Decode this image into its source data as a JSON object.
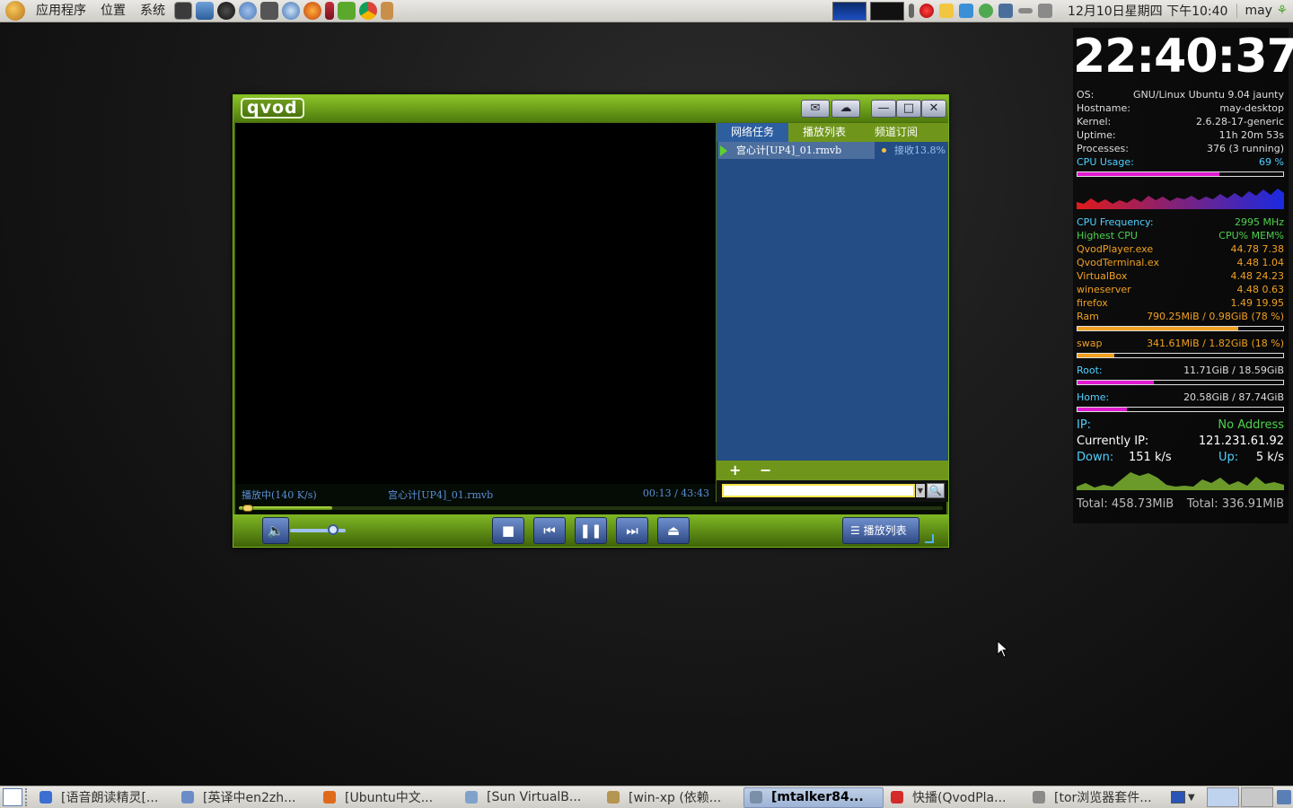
{
  "top_panel": {
    "menus": [
      "应用程序",
      "位置",
      "系统"
    ],
    "datetime": "12月10日星期四 下午10:40",
    "user": "may"
  },
  "conky": {
    "clock": "22:40:37",
    "os_label": "OS:",
    "os_value": "GNU/Linux Ubuntu 9.04 jaunty",
    "hostname_label": "Hostname:",
    "hostname_value": "may-desktop",
    "kernel_label": "Kernel:",
    "kernel_value": "2.6.28-17-generic",
    "uptime_label": "Uptime:",
    "uptime_value": "11h 20m 53s",
    "processes_label": "Processes:",
    "processes_value": "376  (3  running)",
    "cpu_label": "CPU Usage:",
    "cpu_value": "69 %",
    "cpu_fraction": 0.69,
    "freq_label": "CPU Frequency:",
    "freq_value": "2995  MHz",
    "highest_label": "Highest CPU",
    "highest_cols": "CPU% MEM%",
    "procs": [
      {
        "name": "QvodPlayer.exe",
        "vals": "44.78  7.38"
      },
      {
        "name": "QvodTerminal.ex",
        "vals": "4.48  1.04"
      },
      {
        "name": "VirtualBox",
        "vals": "4.48 24.23"
      },
      {
        "name": "wineserver",
        "vals": "4.48  0.63"
      },
      {
        "name": "firefox",
        "vals": "1.49 19.95"
      }
    ],
    "ram_label": "Ram",
    "ram_value": "790.25MiB / 0.98GiB  (78 %)",
    "ram_fraction": 0.78,
    "swap_label": "swap",
    "swap_value": "341.61MiB / 1.82GiB  (18 %)",
    "swap_fraction": 0.18,
    "root_label": "Root:",
    "root_value": "11.71GiB  / 18.59GiB",
    "root_fraction": 0.37,
    "home_label": "Home:",
    "home_value": "20.58GiB  / 87.74GiB",
    "home_fraction": 0.24,
    "ip_label": "IP:",
    "ip_value": "No Address",
    "current_ip_label": "Currently IP:",
    "current_ip_value": "121.231.61.92",
    "down_label": "Down:",
    "down_value": "151   k/s",
    "up_label": "Up:",
    "up_value": "5    k/s",
    "total_down": "Total: 458.73MiB",
    "total_up": "Total: 336.91MiB"
  },
  "qvod": {
    "logo": "qvod",
    "tabs": [
      "网络任务",
      "播放列表",
      "频道订阅"
    ],
    "task_name": "宫心计[UP4]_01.rmvb",
    "task_status": "接收13.8%",
    "status_play": "播放中(140 K/s)",
    "status_file": "宫心计[UP4]_01.rmvb",
    "status_time": "00:13 / 43:43",
    "seek_fraction": 0.005,
    "volume_fraction": 0.78,
    "add_label": "+",
    "remove_label": "−",
    "playlist_button": "播放列表"
  },
  "taskbar": [
    {
      "label": "[语音朗读精灵[...",
      "color": "#3b6fd1"
    },
    {
      "label": "[英译中en2zh...",
      "color": "#6c8cc8"
    },
    {
      "label": "[Ubuntu中文...",
      "color": "#e06a1c"
    },
    {
      "label": "[Sun VirtualB...",
      "color": "#7ea2cc"
    },
    {
      "label": "[win-xp (依赖...",
      "color": "#b59552"
    },
    {
      "label": "[mtalker84...",
      "color": "#7a8fa8",
      "active": true
    },
    {
      "label": "快播(QvodPla...",
      "color": "#d42a2a"
    },
    {
      "label": "[tor浏览器套件...",
      "color": "#8a8a8a"
    }
  ]
}
